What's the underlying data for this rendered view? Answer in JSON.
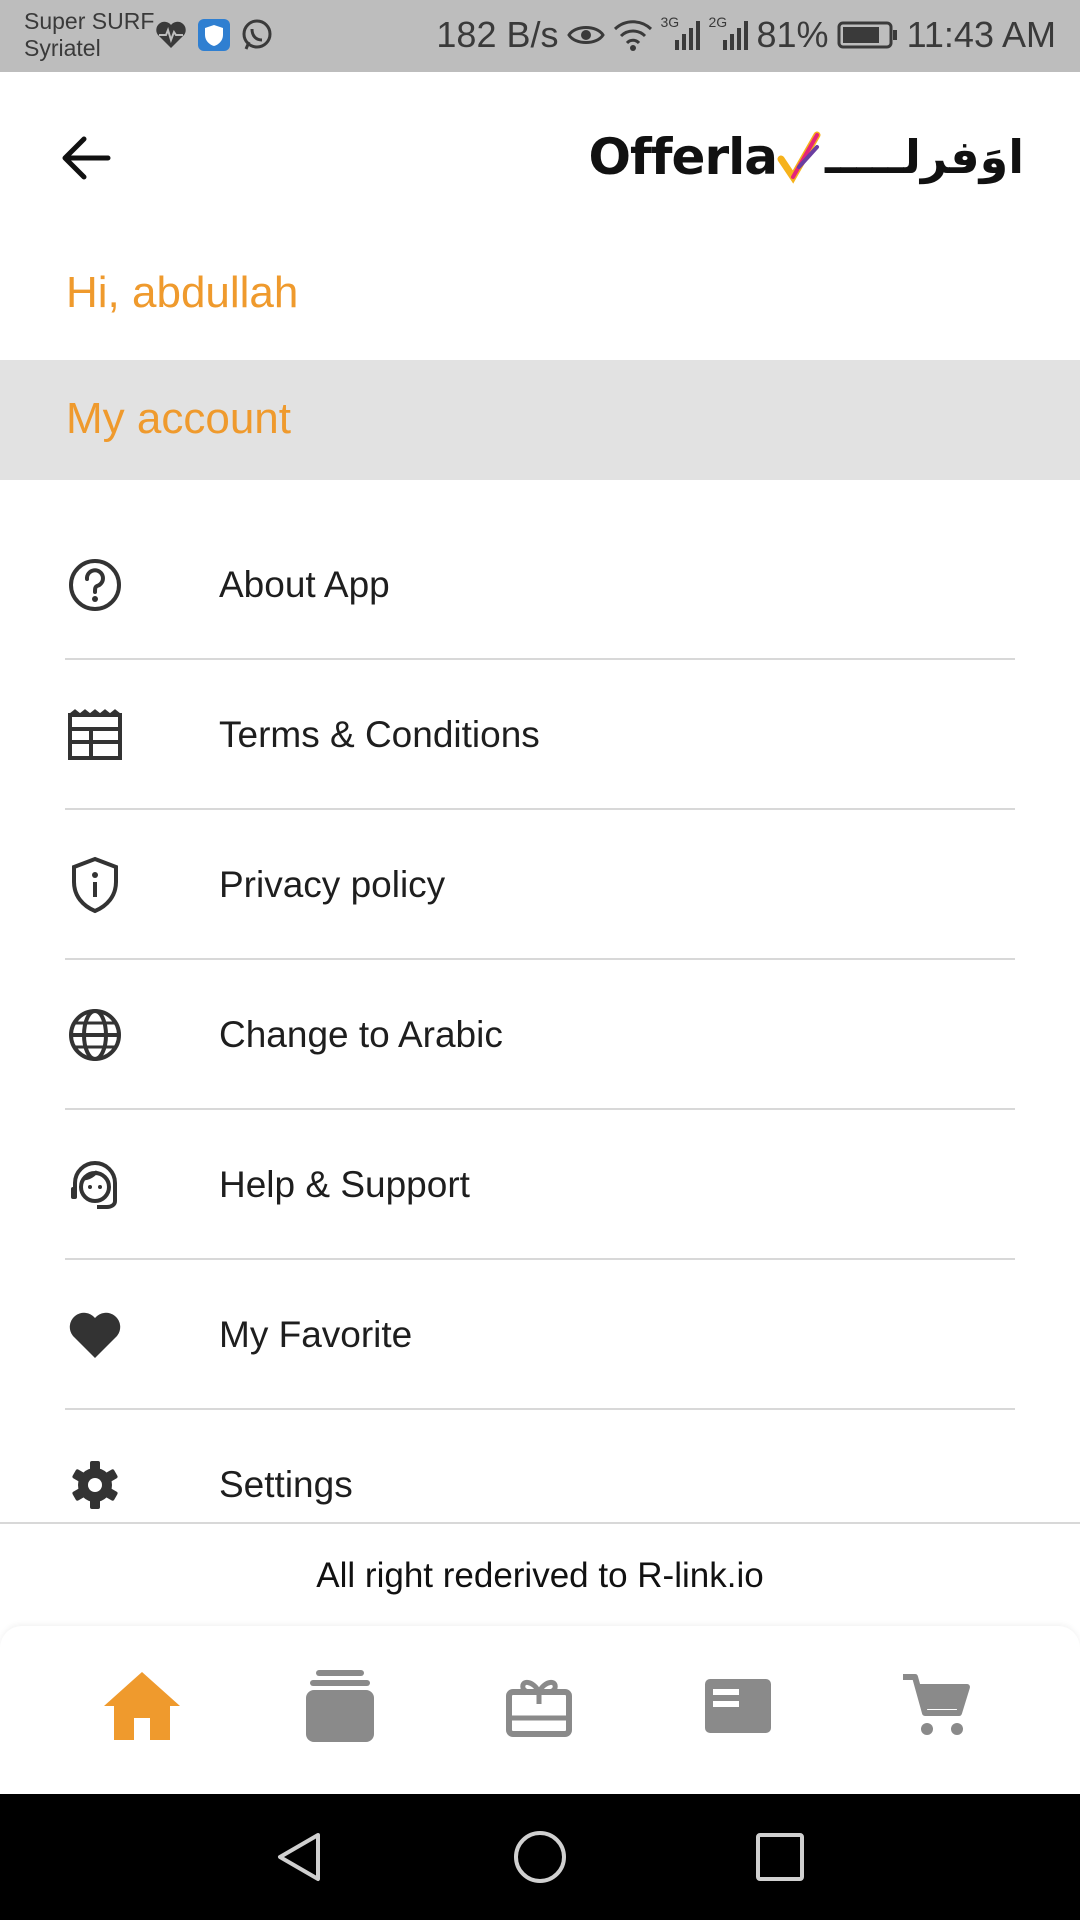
{
  "status_bar": {
    "carrier_line1": "Super SURF",
    "carrier_line2": "Syriatel",
    "net_speed": "182 B/s",
    "net1": "3G",
    "net2": "2G",
    "battery": "81%",
    "time": "11:43 AM",
    "icons_left": [
      "heartbeat-icon",
      "shield-app-icon",
      "whatsapp-icon"
    ]
  },
  "header": {
    "logo_en": "Offerla",
    "logo_ar": "اوَفرلـــــ",
    "brand_colors": [
      "#f6b21b",
      "#e5237a",
      "#6a3ea1"
    ]
  },
  "greeting": "Hi, abdullah",
  "section_title": "My account",
  "menu": [
    {
      "label": "About App",
      "icon": "help-circle-icon"
    },
    {
      "label": "Terms & Conditions",
      "icon": "document-terms-icon"
    },
    {
      "label": "Privacy policy",
      "icon": "shield-info-icon"
    },
    {
      "label": "Change to Arabic",
      "icon": "globe-icon"
    },
    {
      "label": "Help & Support",
      "icon": "headset-icon"
    },
    {
      "label": "My Favorite",
      "icon": "heart-icon"
    },
    {
      "label": "Settings",
      "icon": "gear-icon"
    }
  ],
  "footer": "All right rederived to R-link.io",
  "bottom_nav": [
    {
      "icon": "home-icon",
      "active": true
    },
    {
      "icon": "stack-icon",
      "active": false
    },
    {
      "icon": "gift-card-icon",
      "active": false
    },
    {
      "icon": "card-icon",
      "active": false
    },
    {
      "icon": "cart-icon",
      "active": false
    }
  ],
  "colors": {
    "accent": "#ef9a2d",
    "nav_inactive": "#8a8a8a",
    "section_bg": "#e2e2e2",
    "status_bar_bg": "#bdbdbd"
  }
}
